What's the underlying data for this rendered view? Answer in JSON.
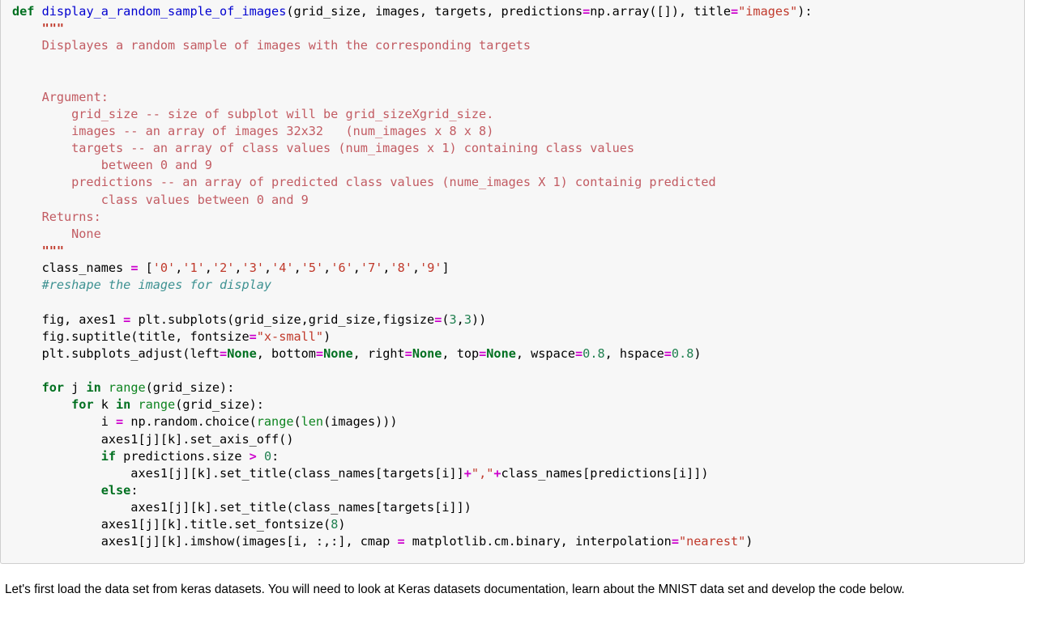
{
  "colors": {
    "cell_background": "#f7f7f7",
    "cell_border": "#cfcfcf",
    "page_background": "#ffffff",
    "keyword": "#007020",
    "function_name": "#0000d0",
    "builtin": "#0e8420",
    "operator": "#cc00cc",
    "number": "#208050",
    "string": "#c0392b",
    "docstring": "#c25b62",
    "comment": "#3d9191",
    "plain_text": "#000000"
  },
  "code_cell": {
    "language": "python",
    "lines": [
      {
        "n": 1,
        "tokens": [
          {
            "t": "kw",
            "s": "def"
          },
          {
            "t": "pln",
            "s": " "
          },
          {
            "t": "fn",
            "s": "display_a_random_sample_of_images"
          },
          {
            "t": "pln",
            "s": "(grid_size, images, targets, predictions"
          },
          {
            "t": "op",
            "s": "="
          },
          {
            "t": "pln",
            "s": "np.array([]), title"
          },
          {
            "t": "op",
            "s": "="
          },
          {
            "t": "str",
            "s": "\"images\""
          },
          {
            "t": "pln",
            "s": "):"
          }
        ]
      },
      {
        "n": 2,
        "tokens": [
          {
            "t": "pln",
            "s": "    "
          },
          {
            "t": "dstr",
            "s": "\"\"\""
          }
        ]
      },
      {
        "n": 3,
        "tokens": [
          {
            "t": "doc",
            "s": "    Displayes a random sample of images with the corresponding targets"
          }
        ]
      },
      {
        "n": 4,
        "tokens": [
          {
            "t": "doc",
            "s": ""
          }
        ]
      },
      {
        "n": 5,
        "tokens": [
          {
            "t": "doc",
            "s": ""
          }
        ]
      },
      {
        "n": 6,
        "tokens": [
          {
            "t": "doc",
            "s": "    Argument:"
          }
        ]
      },
      {
        "n": 7,
        "tokens": [
          {
            "t": "doc",
            "s": "        grid_size -- size of subplot will be grid_sizeXgrid_size."
          }
        ]
      },
      {
        "n": 8,
        "tokens": [
          {
            "t": "doc",
            "s": "        images -- an array of images 32x32   (num_images x 8 x 8)"
          }
        ]
      },
      {
        "n": 9,
        "tokens": [
          {
            "t": "doc",
            "s": "        targets -- an array of class values (num_images x 1) containing class values"
          }
        ]
      },
      {
        "n": 10,
        "tokens": [
          {
            "t": "doc",
            "s": "            between 0 and 9"
          }
        ]
      },
      {
        "n": 11,
        "tokens": [
          {
            "t": "doc",
            "s": "        predictions -- an array of predicted class values (nume_images X 1) containig predicted"
          }
        ]
      },
      {
        "n": 12,
        "tokens": [
          {
            "t": "doc",
            "s": "            class values between 0 and 9"
          }
        ]
      },
      {
        "n": 13,
        "tokens": [
          {
            "t": "doc",
            "s": "    Returns:"
          }
        ]
      },
      {
        "n": 14,
        "tokens": [
          {
            "t": "doc",
            "s": "        None"
          }
        ]
      },
      {
        "n": 15,
        "tokens": [
          {
            "t": "pln",
            "s": "    "
          },
          {
            "t": "dstr",
            "s": "\"\"\""
          }
        ]
      },
      {
        "n": 16,
        "tokens": [
          {
            "t": "pln",
            "s": "    class_names "
          },
          {
            "t": "op",
            "s": "="
          },
          {
            "t": "pln",
            "s": " ["
          },
          {
            "t": "str",
            "s": "'0'"
          },
          {
            "t": "pln",
            "s": ","
          },
          {
            "t": "str",
            "s": "'1'"
          },
          {
            "t": "pln",
            "s": ","
          },
          {
            "t": "str",
            "s": "'2'"
          },
          {
            "t": "pln",
            "s": ","
          },
          {
            "t": "str",
            "s": "'3'"
          },
          {
            "t": "pln",
            "s": ","
          },
          {
            "t": "str",
            "s": "'4'"
          },
          {
            "t": "pln",
            "s": ","
          },
          {
            "t": "str",
            "s": "'5'"
          },
          {
            "t": "pln",
            "s": ","
          },
          {
            "t": "str",
            "s": "'6'"
          },
          {
            "t": "pln",
            "s": ","
          },
          {
            "t": "str",
            "s": "'7'"
          },
          {
            "t": "pln",
            "s": ","
          },
          {
            "t": "str",
            "s": "'8'"
          },
          {
            "t": "pln",
            "s": ","
          },
          {
            "t": "str",
            "s": "'9'"
          },
          {
            "t": "pln",
            "s": "]"
          }
        ]
      },
      {
        "n": 17,
        "tokens": [
          {
            "t": "pln",
            "s": "    "
          },
          {
            "t": "cmt",
            "s": "#reshape the images for display"
          }
        ]
      },
      {
        "n": 18,
        "tokens": [
          {
            "t": "pln",
            "s": ""
          }
        ]
      },
      {
        "n": 19,
        "tokens": [
          {
            "t": "pln",
            "s": "    fig, axes1 "
          },
          {
            "t": "op",
            "s": "="
          },
          {
            "t": "pln",
            "s": " plt.subplots(grid_size,grid_size,figsize"
          },
          {
            "t": "op",
            "s": "="
          },
          {
            "t": "pln",
            "s": "("
          },
          {
            "t": "num",
            "s": "3"
          },
          {
            "t": "pln",
            "s": ","
          },
          {
            "t": "num",
            "s": "3"
          },
          {
            "t": "pln",
            "s": "))"
          }
        ]
      },
      {
        "n": 20,
        "tokens": [
          {
            "t": "pln",
            "s": "    fig.suptitle(title, fontsize"
          },
          {
            "t": "op",
            "s": "="
          },
          {
            "t": "str",
            "s": "\"x-small\""
          },
          {
            "t": "pln",
            "s": ")"
          }
        ]
      },
      {
        "n": 21,
        "tokens": [
          {
            "t": "pln",
            "s": "    plt.subplots_adjust(left"
          },
          {
            "t": "op",
            "s": "="
          },
          {
            "t": "bltn2",
            "s": "None"
          },
          {
            "t": "pln",
            "s": ", bottom"
          },
          {
            "t": "op",
            "s": "="
          },
          {
            "t": "bltn2",
            "s": "None"
          },
          {
            "t": "pln",
            "s": ", right"
          },
          {
            "t": "op",
            "s": "="
          },
          {
            "t": "bltn2",
            "s": "None"
          },
          {
            "t": "pln",
            "s": ", top"
          },
          {
            "t": "op",
            "s": "="
          },
          {
            "t": "bltn2",
            "s": "None"
          },
          {
            "t": "pln",
            "s": ", wspace"
          },
          {
            "t": "op",
            "s": "="
          },
          {
            "t": "num",
            "s": "0.8"
          },
          {
            "t": "pln",
            "s": ", hspace"
          },
          {
            "t": "op",
            "s": "="
          },
          {
            "t": "num",
            "s": "0.8"
          },
          {
            "t": "pln",
            "s": ")"
          }
        ]
      },
      {
        "n": 22,
        "tokens": [
          {
            "t": "pln",
            "s": ""
          }
        ]
      },
      {
        "n": 23,
        "tokens": [
          {
            "t": "pln",
            "s": "    "
          },
          {
            "t": "kw",
            "s": "for"
          },
          {
            "t": "pln",
            "s": " j "
          },
          {
            "t": "kw",
            "s": "in"
          },
          {
            "t": "pln",
            "s": " "
          },
          {
            "t": "bltn",
            "s": "range"
          },
          {
            "t": "pln",
            "s": "(grid_size):"
          }
        ]
      },
      {
        "n": 24,
        "tokens": [
          {
            "t": "pln",
            "s": "        "
          },
          {
            "t": "kw",
            "s": "for"
          },
          {
            "t": "pln",
            "s": " k "
          },
          {
            "t": "kw",
            "s": "in"
          },
          {
            "t": "pln",
            "s": " "
          },
          {
            "t": "bltn",
            "s": "range"
          },
          {
            "t": "pln",
            "s": "(grid_size):"
          }
        ]
      },
      {
        "n": 25,
        "tokens": [
          {
            "t": "pln",
            "s": "            i "
          },
          {
            "t": "op",
            "s": "="
          },
          {
            "t": "pln",
            "s": " np.random.choice("
          },
          {
            "t": "bltn",
            "s": "range"
          },
          {
            "t": "pln",
            "s": "("
          },
          {
            "t": "bltn",
            "s": "len"
          },
          {
            "t": "pln",
            "s": "(images)))"
          }
        ]
      },
      {
        "n": 26,
        "tokens": [
          {
            "t": "pln",
            "s": "            axes1[j][k].set_axis_off()"
          }
        ]
      },
      {
        "n": 27,
        "tokens": [
          {
            "t": "pln",
            "s": "            "
          },
          {
            "t": "kw",
            "s": "if"
          },
          {
            "t": "pln",
            "s": " predictions.size "
          },
          {
            "t": "op",
            "s": ">"
          },
          {
            "t": "pln",
            "s": " "
          },
          {
            "t": "num",
            "s": "0"
          },
          {
            "t": "pln",
            "s": ":"
          }
        ]
      },
      {
        "n": 28,
        "tokens": [
          {
            "t": "pln",
            "s": "                axes1[j][k].set_title(class_names[targets[i]]"
          },
          {
            "t": "op",
            "s": "+"
          },
          {
            "t": "str",
            "s": "\",\""
          },
          {
            "t": "op",
            "s": "+"
          },
          {
            "t": "pln",
            "s": "class_names[predictions[i]])"
          }
        ]
      },
      {
        "n": 29,
        "tokens": [
          {
            "t": "pln",
            "s": "            "
          },
          {
            "t": "kw",
            "s": "else"
          },
          {
            "t": "pln",
            "s": ":"
          }
        ]
      },
      {
        "n": 30,
        "tokens": [
          {
            "t": "pln",
            "s": "                axes1[j][k].set_title(class_names[targets[i]])"
          }
        ]
      },
      {
        "n": 31,
        "tokens": [
          {
            "t": "pln",
            "s": "            axes1[j][k].title.set_fontsize("
          },
          {
            "t": "num",
            "s": "8"
          },
          {
            "t": "pln",
            "s": ")"
          }
        ]
      },
      {
        "n": 32,
        "tokens": [
          {
            "t": "pln",
            "s": "            axes1[j][k].imshow(images[i, :,:], cmap "
          },
          {
            "t": "op",
            "s": "="
          },
          {
            "t": "pln",
            "s": " matplotlib.cm.binary, interpolation"
          },
          {
            "t": "op",
            "s": "="
          },
          {
            "t": "str",
            "s": "\"nearest\""
          },
          {
            "t": "pln",
            "s": ")"
          }
        ]
      }
    ]
  },
  "markdown": {
    "paragraph": "Let's first load the data set from keras datasets. You will need to look at Keras datasets documentation, learn about the MNIST data set and develop the code below."
  }
}
